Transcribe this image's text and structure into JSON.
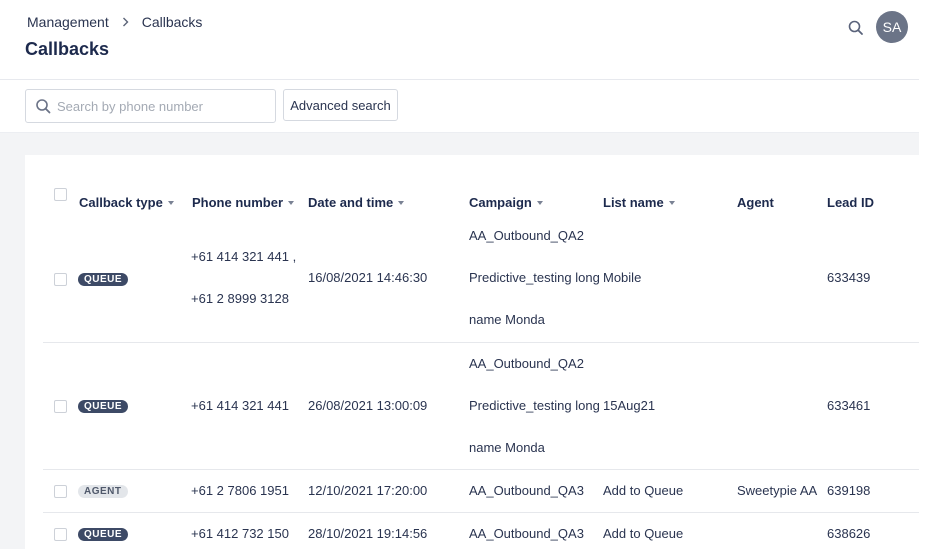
{
  "breadcrumb": {
    "parent": "Management",
    "current": "Callbacks"
  },
  "page": {
    "title": "Callbacks"
  },
  "user": {
    "initials": "SA"
  },
  "search": {
    "placeholder": "Search by phone number",
    "value": ""
  },
  "toolbar": {
    "advanced_search_label": "Advanced search"
  },
  "table": {
    "columns": {
      "type": "Callback type",
      "phone": "Phone number",
      "datetime": "Date and time",
      "campaign": "Campaign",
      "list": "List name",
      "agent": "Agent",
      "lead": "Lead ID"
    },
    "rows": [
      {
        "type": "QUEUE",
        "phone_lines": [
          "+61 414 321 441 ,",
          "+61 2 8999 3128"
        ],
        "datetime": "16/08/2021 14:46:30",
        "campaign_lines": [
          "AA_Outbound_QA2",
          "Predictive_testing long",
          "name Monda"
        ],
        "list": "Mobile",
        "agent": "",
        "lead": "633439"
      },
      {
        "type": "QUEUE",
        "phone_lines": [
          "+61 414 321 441"
        ],
        "datetime": "26/08/2021 13:00:09",
        "campaign_lines": [
          "AA_Outbound_QA2",
          "Predictive_testing long",
          "name Monda"
        ],
        "list": "15Aug21",
        "agent": "",
        "lead": "633461"
      },
      {
        "type": "AGENT",
        "phone_lines": [
          "+61 2 7806 1951"
        ],
        "datetime": "12/10/2021 17:20:00",
        "campaign_lines": [
          "AA_Outbound_QA3"
        ],
        "list": "Add to Queue",
        "agent": "Sweetypie AA",
        "lead": "639198"
      },
      {
        "type": "QUEUE",
        "phone_lines": [
          "+61 412 732 150"
        ],
        "datetime": "28/10/2021 19:14:56",
        "campaign_lines": [
          "AA_Outbound_QA3"
        ],
        "list": "Add to Queue",
        "agent": "",
        "lead": "638626"
      }
    ]
  },
  "colors": {
    "title": "#1d2a4d",
    "badge_queue_bg": "#3d4a66",
    "badge_agent_bg": "#e3e6ea",
    "avatar_bg": "#6b7487",
    "content_bg": "#f3f4f6"
  },
  "icons": [
    "chevron-right-icon",
    "search-icon",
    "sort-caret-icon"
  ]
}
